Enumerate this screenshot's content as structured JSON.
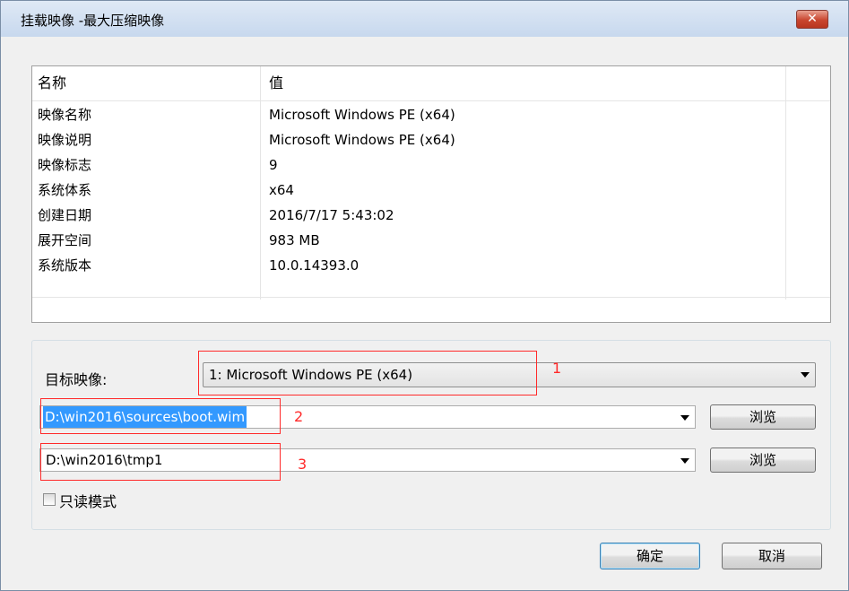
{
  "window": {
    "title": "挂载映像 -最大压缩映像",
    "close_glyph": "✕"
  },
  "table": {
    "columns": [
      "名称",
      "值"
    ],
    "rows": [
      {
        "name": "映像名称",
        "value": "Microsoft Windows PE (x64)"
      },
      {
        "name": "映像说明",
        "value": "Microsoft Windows PE (x64)"
      },
      {
        "name": "映像标志",
        "value": "9"
      },
      {
        "name": "系统体系",
        "value": "x64"
      },
      {
        "name": "创建日期",
        "value": "2016/7/17 5:43:02"
      },
      {
        "name": "展开空间",
        "value": "983 MB"
      },
      {
        "name": "系统版本",
        "value": "10.0.14393.0"
      }
    ]
  },
  "form": {
    "target_image_label": "目标映像:",
    "target_image_value": "1: Microsoft Windows PE (x64)",
    "wim_path_value": "D:\\win2016\\sources\\boot.wim",
    "mount_dir_value": "D:\\win2016\\tmp1",
    "browse_label": "浏览",
    "readonly_label": "只读模式",
    "readonly_checked": false
  },
  "annotations": [
    "1",
    "2",
    "3"
  ],
  "buttons": {
    "ok": "确定",
    "cancel": "取消"
  },
  "colors": {
    "annotation": "#ff2a2a",
    "selection": "#3399ff",
    "title_bar": "#c7d8ee"
  }
}
